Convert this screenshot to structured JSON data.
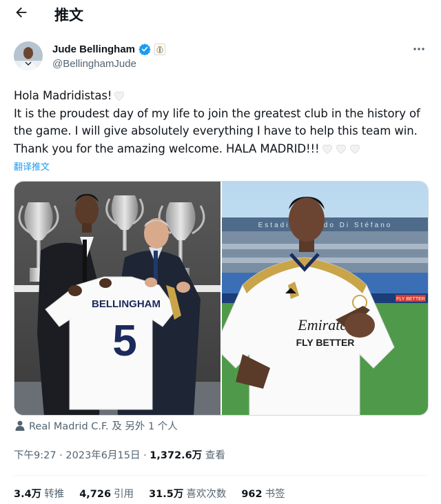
{
  "header": {
    "title": "推文"
  },
  "author": {
    "name": "Jude Bellingham",
    "handle": "@BellinghamJude"
  },
  "tweet": {
    "lines": [
      "Hola Madridistas!",
      "It is the proudest day of my life to join the greatest club in the history of",
      "the game. I will give absolutely everything I have to help this team win.",
      "Thank you for the amazing welcome. HALA MADRID!!!"
    ],
    "translate_label": "翻译推文"
  },
  "media": {
    "photo1": {
      "shirt_name": "BELLINGHAM",
      "shirt_number": "5"
    },
    "photo2": {
      "sponsor_line1": "Emirates",
      "sponsor_line2": "FLY BETTER",
      "stadium_text": "Estadio Alfredo Di Stéfano",
      "board_text": "FLY BETTER"
    }
  },
  "tagged": {
    "label": "Real Madrid C.F. 及 另外 1 个人"
  },
  "meta": {
    "time_date": "下午9:27 · 2023年6月15日 · ",
    "views_value": "1,372.6万",
    "views_label": " 查看"
  },
  "stats": {
    "retweets_value": "3.4万",
    "retweets_label": "转推",
    "quotes_value": "4,726",
    "quotes_label": "引用",
    "likes_value": "31.5万",
    "likes_label": "喜欢次数",
    "bookmarks_value": "962",
    "bookmarks_label": "书签"
  },
  "colors": {
    "link": "#1d9bf0",
    "secondary": "#536471",
    "verified": "#1d9bf0",
    "real_madrid_gold": "#c9a449"
  }
}
